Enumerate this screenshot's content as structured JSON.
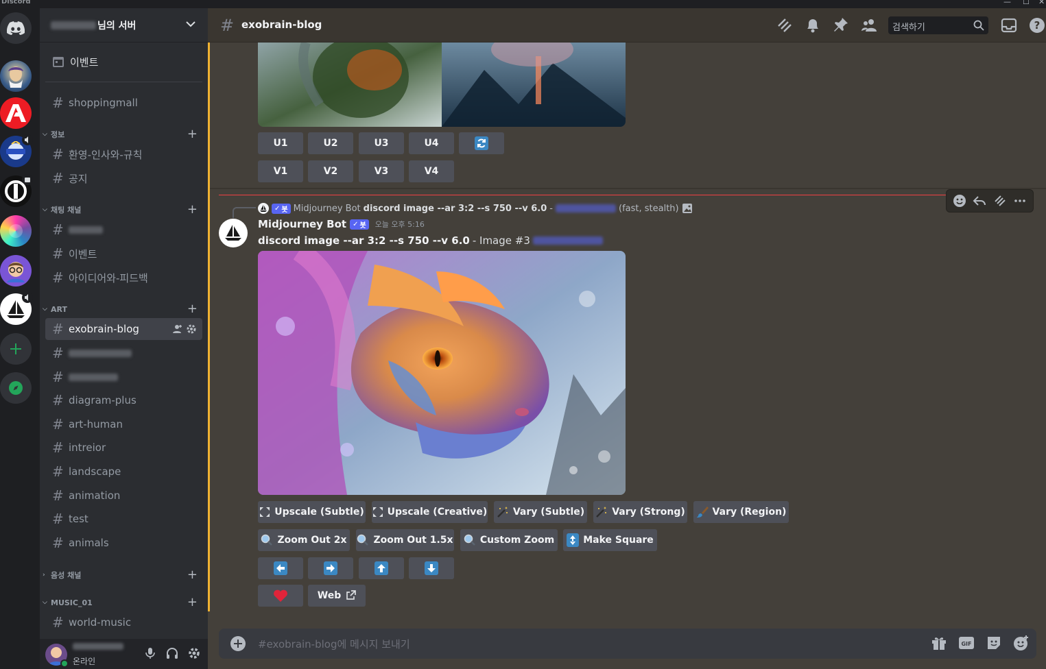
{
  "window": {
    "brand": "Discord",
    "controls": [
      "—",
      "☐",
      "✕"
    ]
  },
  "server": {
    "name_suffix": "님의 서버"
  },
  "sidebar": {
    "events_label": "이벤트",
    "top_channels": [
      {
        "name": "shoppingmall"
      }
    ],
    "categories": [
      {
        "name": "정보",
        "channels": [
          "환영-인사와-규칙",
          "공지"
        ]
      },
      {
        "name": "채팅 채널",
        "channels": [
          "",
          "이벤트",
          "아이디어와-피드백"
        ]
      },
      {
        "name": "ART",
        "channels": [
          "exobrain-blog",
          "",
          "",
          "diagram-plus",
          "art-human",
          "intreior",
          "landscape",
          "animation",
          "test",
          "animals"
        ]
      },
      {
        "name": "음성 채널",
        "channels": []
      },
      {
        "name": "MUSIC_01",
        "channels": [
          "world-music"
        ]
      }
    ],
    "active_channel": "exobrain-blog"
  },
  "user": {
    "status": "온라인"
  },
  "topbar": {
    "channel": "exobrain-blog",
    "search_placeholder": "검색하기"
  },
  "prev_message": {
    "upscale_buttons": [
      "U1",
      "U2",
      "U3",
      "U4"
    ],
    "variation_buttons": [
      "V1",
      "V2",
      "V3",
      "V4"
    ]
  },
  "message": {
    "reply": {
      "author": "Midjourney Bot",
      "bot_tag": "봇",
      "prompt": "discord image --ar 3:2 --s 750 --v 6.0",
      "dash": "-",
      "suffix": "(fast, stealth)"
    },
    "author": "Midjourney Bot",
    "bot_tag": "봇",
    "timestamp": "오늘 오후 5:16",
    "prompt": "discord image --ar 3:2 --s 750 --v 6.0",
    "image_label": "- Image #3",
    "action_row1": [
      "Upscale (Subtle)",
      "Upscale (Creative)",
      "Vary (Subtle)",
      "Vary (Strong)",
      "Vary (Region)"
    ],
    "action_row2": [
      "Zoom Out 2x",
      "Zoom Out 1.5x",
      "Custom Zoom",
      "Make Square"
    ],
    "web_label": "Web"
  },
  "composer": {
    "placeholder": "#exobrain-blog에 메시지 보내기"
  },
  "colors": {
    "accent": "#5865f2",
    "highlight": "#f0b232",
    "new_line": "#f23f43",
    "button": "#4e5058"
  }
}
